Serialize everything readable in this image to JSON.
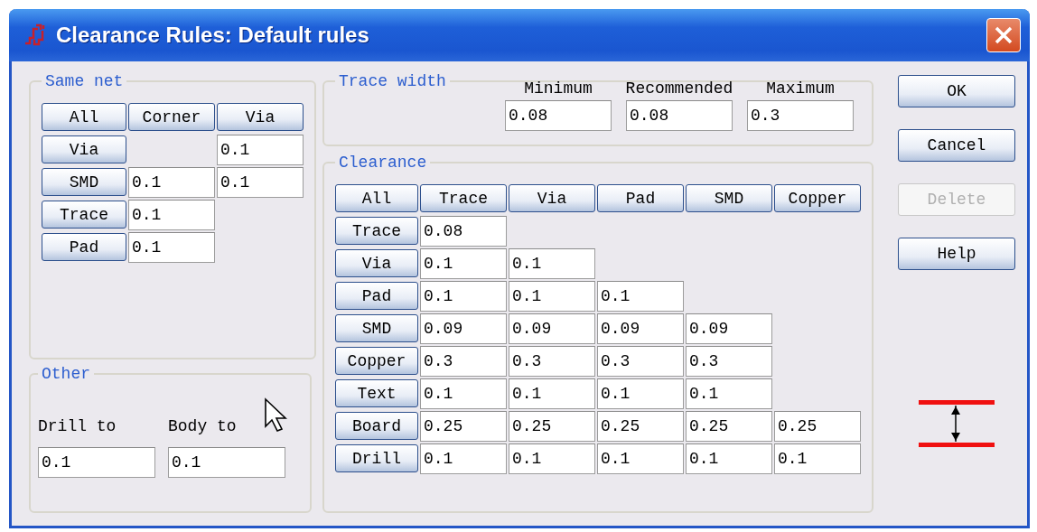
{
  "window": {
    "title": "Clearance Rules: Default rules"
  },
  "same_net": {
    "title": "Same net",
    "header": [
      "All",
      "Corner",
      "Via"
    ],
    "rows": [
      {
        "label": "Via",
        "via": "0.1"
      },
      {
        "label": "SMD",
        "corner": "0.1",
        "via": "0.1"
      },
      {
        "label": "Trace",
        "corner": "0.1"
      },
      {
        "label": "Pad",
        "corner": "0.1"
      }
    ]
  },
  "other": {
    "title": "Other",
    "fields": [
      {
        "label": "Drill to",
        "value": "0.1"
      },
      {
        "label": "Body to",
        "value": "0.1"
      }
    ]
  },
  "trace_width": {
    "title": "Trace width",
    "fields": [
      {
        "label": "Minimum",
        "value": "0.08"
      },
      {
        "label": "Recommended",
        "value": "0.08"
      },
      {
        "label": "Maximum",
        "value": "0.3"
      }
    ]
  },
  "clearance": {
    "title": "Clearance",
    "header": [
      "All",
      "Trace",
      "Via",
      "Pad",
      "SMD",
      "Copper"
    ],
    "rows": [
      {
        "label": "Trace",
        "values": [
          "0.08"
        ]
      },
      {
        "label": "Via",
        "values": [
          "0.1",
          "0.1"
        ]
      },
      {
        "label": "Pad",
        "values": [
          "0.1",
          "0.1",
          "0.1"
        ]
      },
      {
        "label": "SMD",
        "values": [
          "0.09",
          "0.09",
          "0.09",
          "0.09"
        ]
      },
      {
        "label": "Copper",
        "values": [
          "0.3",
          "0.3",
          "0.3",
          "0.3"
        ]
      },
      {
        "label": "Text",
        "values": [
          "0.1",
          "0.1",
          "0.1",
          "0.1"
        ]
      },
      {
        "label": "Board",
        "values": [
          "0.25",
          "0.25",
          "0.25",
          "0.25",
          "0.25"
        ]
      },
      {
        "label": "Drill",
        "values": [
          "0.1",
          "0.1",
          "0.1",
          "0.1",
          "0.1"
        ]
      }
    ]
  },
  "buttons": [
    {
      "label": "OK",
      "disabled": false
    },
    {
      "label": "Cancel",
      "disabled": false
    },
    {
      "label": "Delete",
      "disabled": true
    },
    {
      "label": "Help",
      "disabled": false
    }
  ]
}
